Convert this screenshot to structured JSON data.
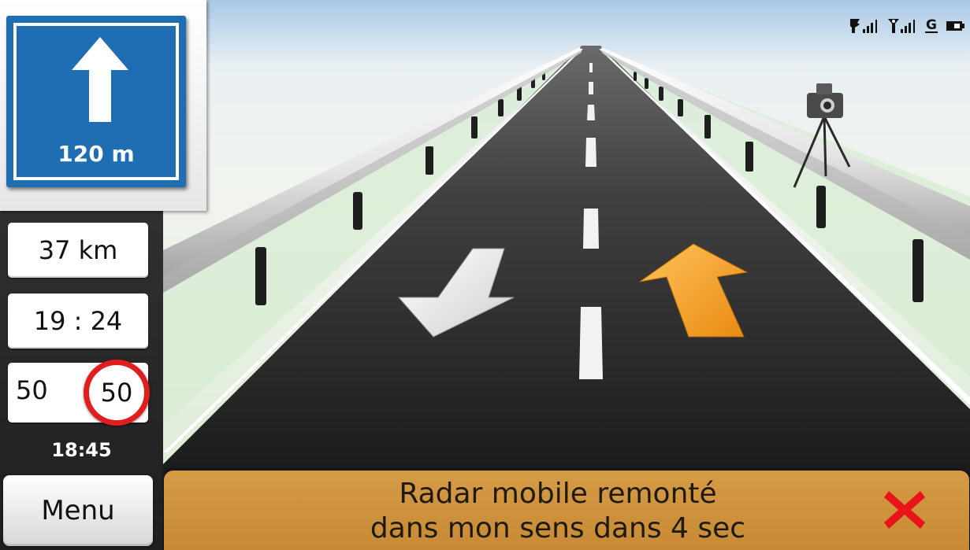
{
  "maneuver": {
    "distance": "120 m",
    "direction_icon": "arrow-straight-up-icon",
    "sign_color": "#1f6db3"
  },
  "trip": {
    "remaining_distance": "37 km",
    "arrival_time": "19 : 24",
    "current_speed": "50",
    "speed_limit": "50",
    "clock": "18:45"
  },
  "menu": {
    "label": "Menu"
  },
  "status_icons": [
    "gps-satellite-signal-icon",
    "gsm-signal-icon",
    "gprs-icon",
    "battery-icon"
  ],
  "alert": {
    "line1": "Radar mobile remonté",
    "line2": "dans mon sens dans 4 sec",
    "banner_color": "#d09541",
    "close_icon": "close-icon",
    "close_color": "#e8141a"
  },
  "scene": {
    "left_arrow_color": "#f2f2f2",
    "right_arrow_color": "#f5a623",
    "camera_icon": "speed-camera-icon"
  }
}
